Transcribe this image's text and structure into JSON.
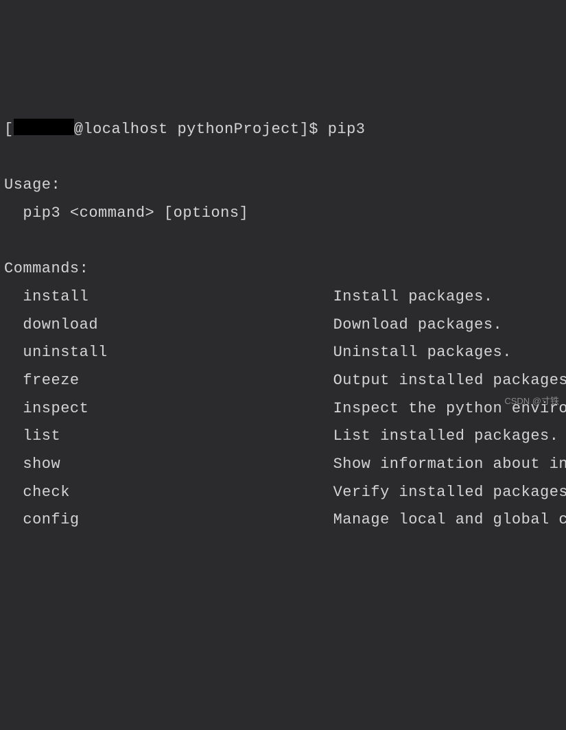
{
  "prompt": {
    "prefix": "[",
    "user_host": "@localhost",
    "cwd": "pythonProject",
    "suffix": "]$",
    "command": "pip3"
  },
  "output": {
    "usage_header": "Usage:",
    "usage_line": "  pip3 <command> [options]",
    "commands_header": "Commands:",
    "commands": [
      {
        "name": "install",
        "desc": "Install packages."
      },
      {
        "name": "download",
        "desc": "Download packages."
      },
      {
        "name": "uninstall",
        "desc": "Uninstall packages."
      },
      {
        "name": "freeze",
        "desc": "Output installed packages"
      },
      {
        "name": "inspect",
        "desc": "Inspect the python enviro"
      },
      {
        "name": "list",
        "desc": "List installed packages."
      },
      {
        "name": "show",
        "desc": "Show information about in"
      },
      {
        "name": "check",
        "desc": "Verify installed packages"
      },
      {
        "name": "config",
        "desc": "Manage local and global c"
      }
    ]
  },
  "watermark": "CSDN @寸铁"
}
